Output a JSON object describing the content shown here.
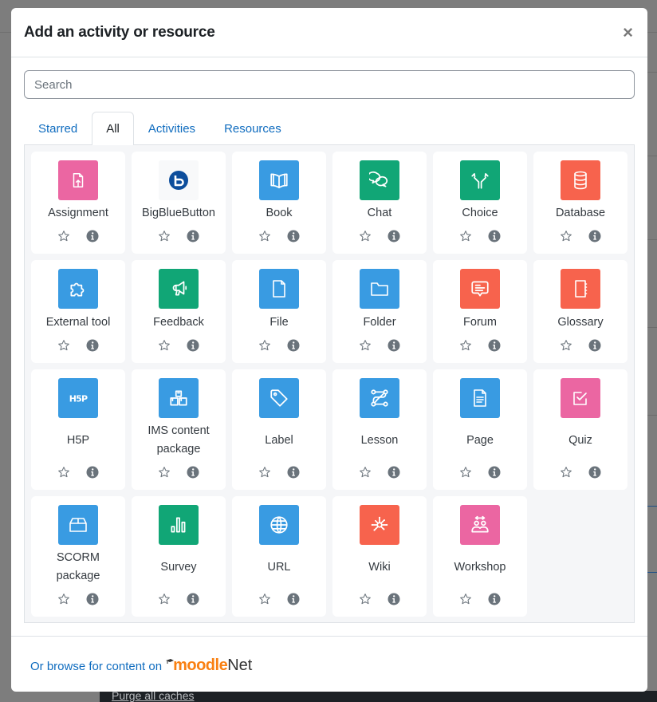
{
  "background": {
    "footer_link": "Purge all caches"
  },
  "modal": {
    "title": "Add an activity or resource",
    "close_label": "×",
    "search": {
      "placeholder": "Search",
      "value": ""
    },
    "tabs": [
      {
        "label": "Starred",
        "active": false
      },
      {
        "label": "All",
        "active": true
      },
      {
        "label": "Activities",
        "active": false
      },
      {
        "label": "Resources",
        "active": false
      }
    ],
    "items": [
      {
        "name": "Assignment",
        "icon": "assignment-icon",
        "color": "#eb66a2"
      },
      {
        "name": "BigBlueButton",
        "icon": "bigbluebutton-icon",
        "color": "#f8f9fa"
      },
      {
        "name": "Book",
        "icon": "book-icon",
        "color": "#399be2"
      },
      {
        "name": "Chat",
        "icon": "chat-icon",
        "color": "#11a676"
      },
      {
        "name": "Choice",
        "icon": "choice-icon",
        "color": "#11a676"
      },
      {
        "name": "Database",
        "icon": "database-icon",
        "color": "#f7634d"
      },
      {
        "name": "External tool",
        "icon": "puzzle-icon",
        "color": "#399be2"
      },
      {
        "name": "Feedback",
        "icon": "megaphone-icon",
        "color": "#11a676"
      },
      {
        "name": "File",
        "icon": "file-icon",
        "color": "#399be2"
      },
      {
        "name": "Folder",
        "icon": "folder-icon",
        "color": "#399be2"
      },
      {
        "name": "Forum",
        "icon": "forum-icon",
        "color": "#f7634d"
      },
      {
        "name": "Glossary",
        "icon": "glossary-icon",
        "color": "#f7634d"
      },
      {
        "name": "H5P",
        "icon": "h5p-icon",
        "color": "#399be2"
      },
      {
        "name": "IMS content package",
        "icon": "ims-package-icon",
        "color": "#399be2"
      },
      {
        "name": "Label",
        "icon": "tag-icon",
        "color": "#399be2"
      },
      {
        "name": "Lesson",
        "icon": "lesson-icon",
        "color": "#399be2"
      },
      {
        "name": "Page",
        "icon": "page-icon",
        "color": "#399be2"
      },
      {
        "name": "Quiz",
        "icon": "quiz-icon",
        "color": "#eb66a2"
      },
      {
        "name": "SCORM package",
        "icon": "scorm-icon",
        "color": "#399be2"
      },
      {
        "name": "Survey",
        "icon": "survey-icon",
        "color": "#11a676"
      },
      {
        "name": "URL",
        "icon": "globe-icon",
        "color": "#399be2"
      },
      {
        "name": "Wiki",
        "icon": "wiki-icon",
        "color": "#f7634d"
      },
      {
        "name": "Workshop",
        "icon": "workshop-icon",
        "color": "#eb66a2"
      }
    ],
    "footer": {
      "browse_text": "Or browse for content on",
      "logo_moodle": "moodle",
      "logo_net": "Net"
    }
  }
}
